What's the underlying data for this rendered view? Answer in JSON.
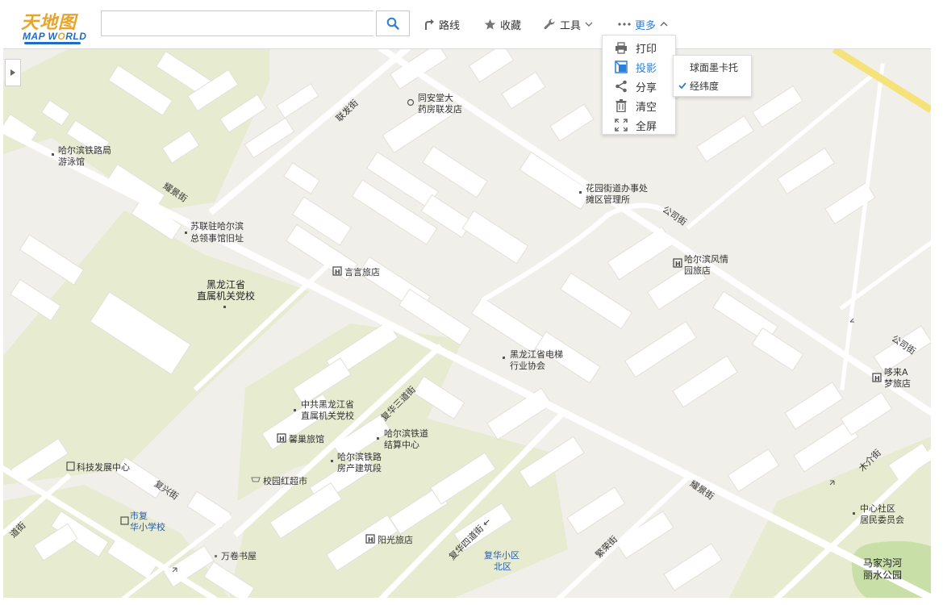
{
  "app": {
    "logo_cn": "天地图",
    "logo_en_a": "MAP W",
    "logo_en_o": "O",
    "logo_en_b": "RLD"
  },
  "search": {
    "value": "",
    "placeholder": ""
  },
  "nav": {
    "route_label": "路线",
    "favorites_label": "收藏",
    "tools_label": "工具",
    "more_label": "更多"
  },
  "more_menu": {
    "items": [
      {
        "label": "打印",
        "icon": "printer-icon"
      },
      {
        "label": "投影",
        "icon": "projection-icon"
      },
      {
        "label": "分享",
        "icon": "share-icon"
      },
      {
        "label": "清空",
        "icon": "trash-icon"
      },
      {
        "label": "全屏",
        "icon": "fullscreen-icon"
      }
    ],
    "active_index": 1
  },
  "projection_menu": {
    "items": [
      {
        "label": "球面墨卡托",
        "checked": false
      },
      {
        "label": "经纬度",
        "checked": true
      }
    ]
  },
  "colors": {
    "accent": "#2b7fd6",
    "logo_gold": "#e8a42a",
    "logo_blue": "#1e6cc8",
    "map_bg": "#f1efe9",
    "green_area": "#e7ebd0",
    "building": "#ffffff",
    "road_yellow": "#f5e27a",
    "park": "#c9dfa8"
  },
  "map": {
    "roads": {
      "lianfa": "联发街",
      "yaojing_w": "耀景街",
      "gongsi_n": "公司街",
      "gongsi_e": "公司街",
      "fuhua3": "复华三道街",
      "fuxing": "复兴街",
      "fuhua4": "复华四道街 ←",
      "fanrong": "繁荣街",
      "yaojing_s": "耀景街",
      "mujie": "木介街",
      "road_left": "道街"
    },
    "pois": {
      "tongantang_1": "同安堂大",
      "tongantang_2": "药房联发店",
      "hrb_pool_1": "哈尔滨铁路局",
      "hrb_pool_2": "游泳馆",
      "huayuan_1": "花园街道办事处",
      "huayuan_2": "摊区管理所",
      "suliian_1": "苏联驻哈尔滨",
      "suliian_2": "总领事馆旧址",
      "yanyan": "言言旅店",
      "fengqing_1": "哈尔滨风情",
      "fengqing_2": "园旅店",
      "hlj_party_1": "黑龙江省",
      "hlj_party_2": "直属机关党校",
      "elevator_1": "黑龙江省电梯",
      "elevator_2": "行业协会",
      "duolai_1": "哆来A",
      "duolai_2": "梦旅店",
      "ccp_school_1": "中共黑龙江省",
      "ccp_school_2": "直属机关党校",
      "rail_center_1": "哈尔滨铁道",
      "rail_center_2": "结算中心",
      "xinchao": "馨巢旅馆",
      "rail_build_1": "哈尔滨铁路",
      "rail_build_2": "房产建筑段",
      "tech_center": "科技发展中心",
      "campus_mkt": "校园红超市",
      "fuhua_school_1": "市复",
      "fuhua_school_2": "华小学校",
      "yangguang": "阳光旅店",
      "wanjuan": "万卷书屋",
      "fuhua_north_1": "复华小区",
      "fuhua_north_2": "北区",
      "community_1": "中心社区",
      "community_2": "居民委员会",
      "park_1": "马家沟河",
      "park_2": "丽水公园"
    }
  }
}
